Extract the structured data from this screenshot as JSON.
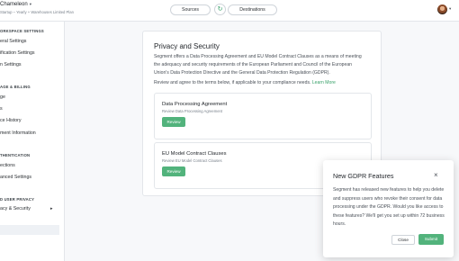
{
  "header": {
    "workspace_name": "Chameleon",
    "workspace_plan": "Startup – Yearly + Warehouses Limited Plan",
    "sources_label": "Sources",
    "destinations_label": "Destinations",
    "sync_icon": "sync-icon",
    "avatar_icon": "user-avatar"
  },
  "sidebar": {
    "sections": [
      {
        "title": "ORKSPACE SETTINGS",
        "items": [
          "eral Settings",
          "ification Settings",
          "n Settings"
        ]
      },
      {
        "title": "AGE & BILLING",
        "items": [
          "ge",
          "s",
          "ce History",
          "ment Information"
        ]
      },
      {
        "title": "THENTICATION",
        "items": [
          "ections",
          "anced Settings"
        ]
      },
      {
        "title": "D USER PRIVACY",
        "items": [
          "acy & Security"
        ]
      }
    ],
    "active_item": "acy & Security"
  },
  "main": {
    "title": "Privacy and Security",
    "description": "Segment offers a Data Processing Agreement and EU Model Contract Clauses as a means of meeting the adequacy and security requirements of the European Parliament and Council of the European Union's Data Protection Directive and the General Data Protection Regulation (GDPR).",
    "review_text": "Review and agree to the terms below, if applicable to your compliance needs.",
    "learn_more": "Learn More",
    "agreements": [
      {
        "title": "Data Processing Agreement",
        "subtitle": "Review Data Processing Agreement",
        "button": "Review"
      },
      {
        "title": "EU Model Contract Clauses",
        "subtitle": "Review EU Model Contract Clauses",
        "button": "Review"
      }
    ]
  },
  "modal": {
    "title": "New GDPR Features",
    "body": "Segment has released new features to help you delete and suppress users who revoke their consent for data processing under the GDPR. Would you like access to these features? We'll get you set up within 72 business hours.",
    "close_label": "Close",
    "submit_label": "Submit",
    "close_icon": "×"
  },
  "colors": {
    "accent": "#52b37c",
    "link": "#38a169"
  }
}
